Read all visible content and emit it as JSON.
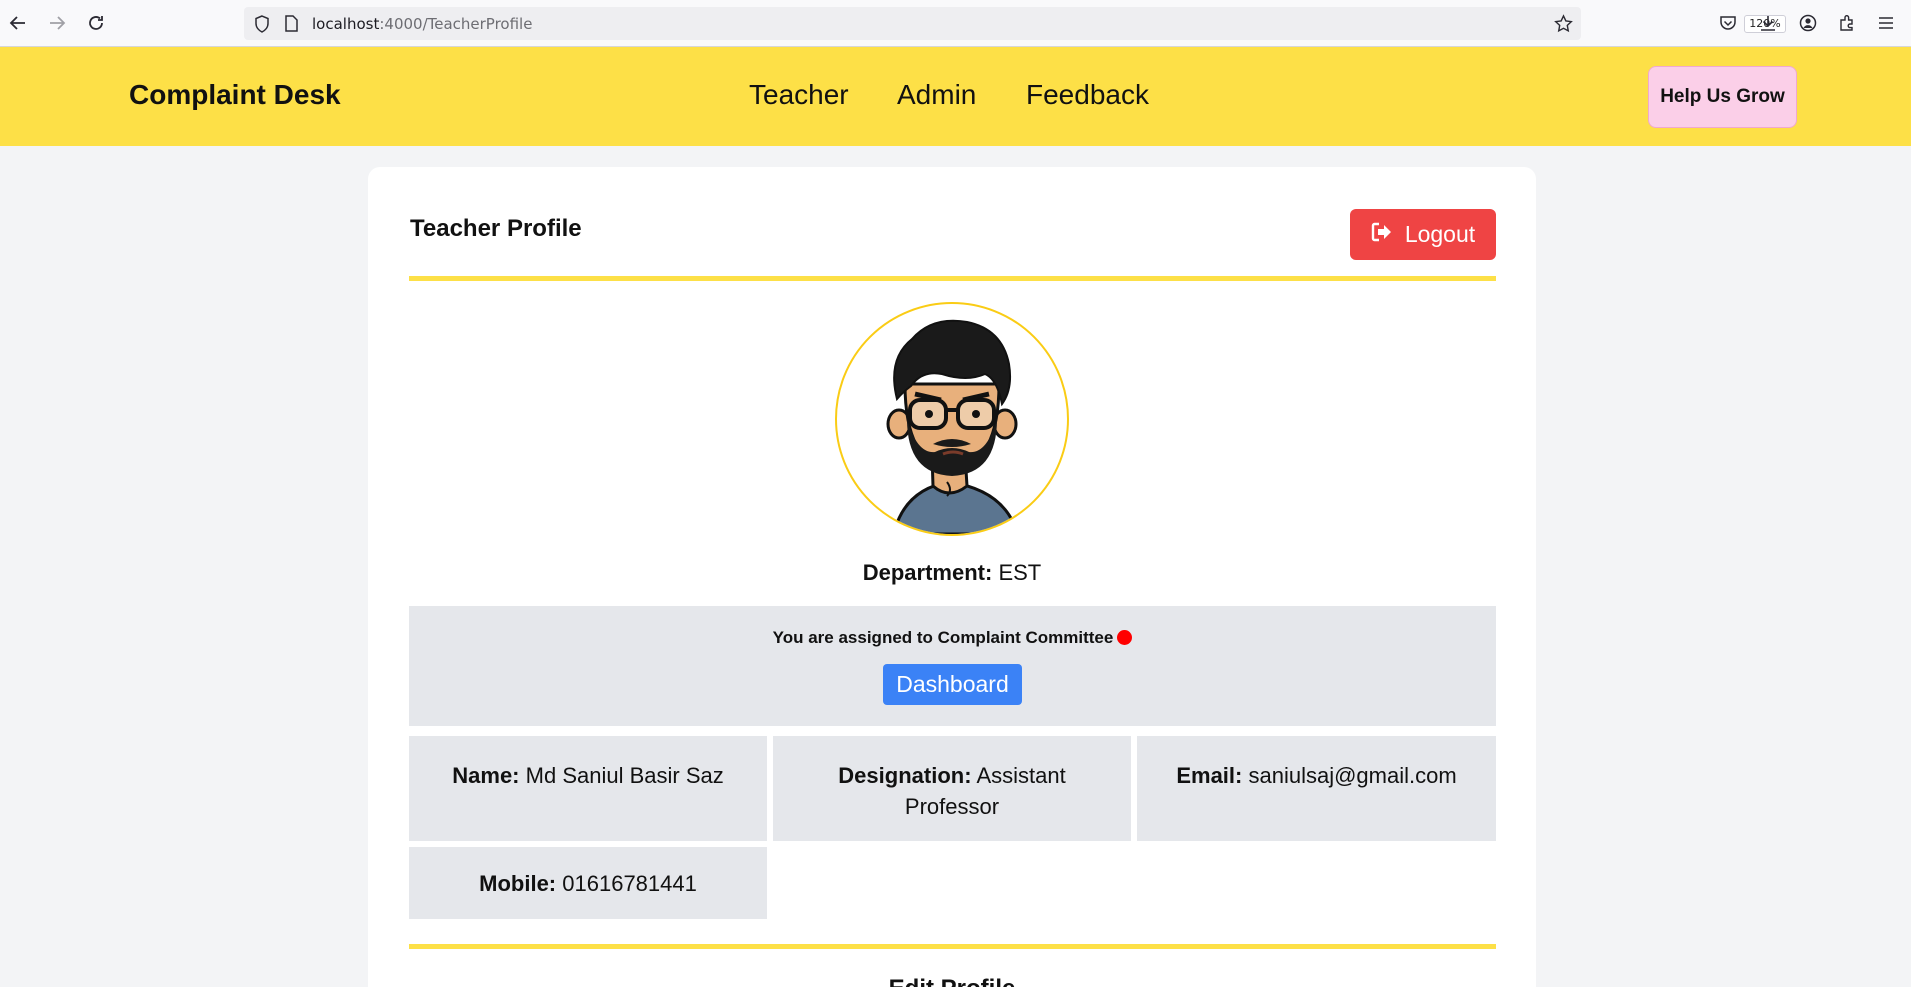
{
  "browser": {
    "url_host": "localhost",
    "url_path": ":4000/TeacherProfile",
    "zoom": "120%"
  },
  "header": {
    "brand": "Complaint Desk",
    "nav": [
      {
        "label": "Teacher"
      },
      {
        "label": "Admin"
      },
      {
        "label": "Feedback"
      }
    ],
    "help_label": "Help Us Grow"
  },
  "profile": {
    "title": "Teacher Profile",
    "logout_label": "Logout",
    "department_label": "Department:",
    "department_value": "EST",
    "committee_text": "You are assigned to Complaint Committee",
    "dashboard_label": "Dashboard",
    "name_label": "Name:",
    "name_value": "Md Saniul Basir Saz",
    "designation_label": "Designation:",
    "designation_value": "Assistant Professor",
    "email_label": "Email:",
    "email_value": "saniulsaj@gmail.com",
    "mobile_label": "Mobile:",
    "mobile_value": "01616781441",
    "edit_heading": "Edit Profile"
  },
  "colors": {
    "header_bg": "#fde047",
    "help_bg": "#fbcfe8",
    "logout_bg": "#ef4444",
    "dashboard_bg": "#3b82f6",
    "panel_bg": "#e5e7eb",
    "status_dot": "#ff0000"
  },
  "icons": [
    "back-arrow-icon",
    "forward-arrow-icon",
    "reload-icon",
    "shield-icon",
    "page-icon",
    "bookmark-star-icon",
    "pocket-icon",
    "download-icon",
    "account-icon",
    "extensions-icon",
    "menu-icon",
    "logout-icon"
  ]
}
